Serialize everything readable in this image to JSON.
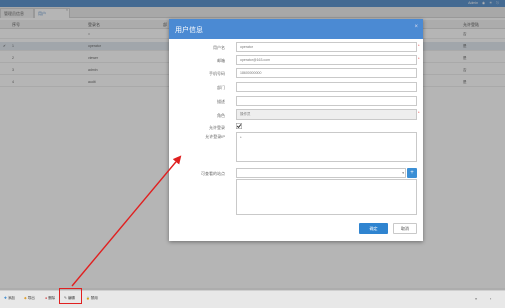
{
  "topbar": {
    "right_items": [
      "Admin",
      "◉",
      "☀",
      "⎋"
    ]
  },
  "tabs": [
    {
      "label": "管理员信息"
    },
    {
      "label": "用户",
      "close": "×"
    }
  ],
  "grid": {
    "headers": [
      "序号",
      "登录名",
      "部",
      "允许登陆"
    ],
    "filter": [
      "",
      "=",
      "",
      "否"
    ],
    "rows": [
      {
        "no": "1",
        "check": "✔",
        "user": "operator",
        "allow": "是"
      },
      {
        "no": "2",
        "check": "",
        "user": "viewer",
        "allow": "是"
      },
      {
        "no": "3",
        "check": "",
        "user": "admin",
        "allow": "否"
      },
      {
        "no": "4",
        "check": "",
        "user": "audit",
        "allow": "是"
      }
    ]
  },
  "modal": {
    "title": "用户信息",
    "close": "×",
    "fields": {
      "username": {
        "label": "用户名",
        "value": "operator"
      },
      "email": {
        "label": "邮箱",
        "value": "operator@163.com"
      },
      "phone": {
        "label": "手机号码",
        "value": "18600000000"
      },
      "dept": {
        "label": "部门",
        "value": ""
      },
      "desc": {
        "label": "描述",
        "value": ""
      },
      "role": {
        "label": "角色",
        "value": "操作员"
      },
      "allow_login": {
        "label": "允许登录",
        "checked": true
      },
      "allow_ip": {
        "label": "允许登录IP",
        "value": "*"
      },
      "data_range": {
        "label": "可查看的站点",
        "value": ""
      }
    },
    "ok": "确定",
    "cancel": "取消",
    "plus": "+",
    "required_mark": "*"
  },
  "toolbar": {
    "buttons": [
      {
        "icon": "✚",
        "label": "添加"
      },
      {
        "icon": "◆",
        "label": "导出"
      },
      {
        "icon": "●",
        "label": "删除"
      },
      {
        "icon": "✎",
        "label": "编辑"
      },
      {
        "icon": "🔒",
        "label": "禁用"
      }
    ],
    "pager": [
      "«",
      "‹"
    ]
  },
  "colors": {
    "accent": "#4b8ad3",
    "topbar": "#4a86c7",
    "highlight": "#e02020"
  }
}
